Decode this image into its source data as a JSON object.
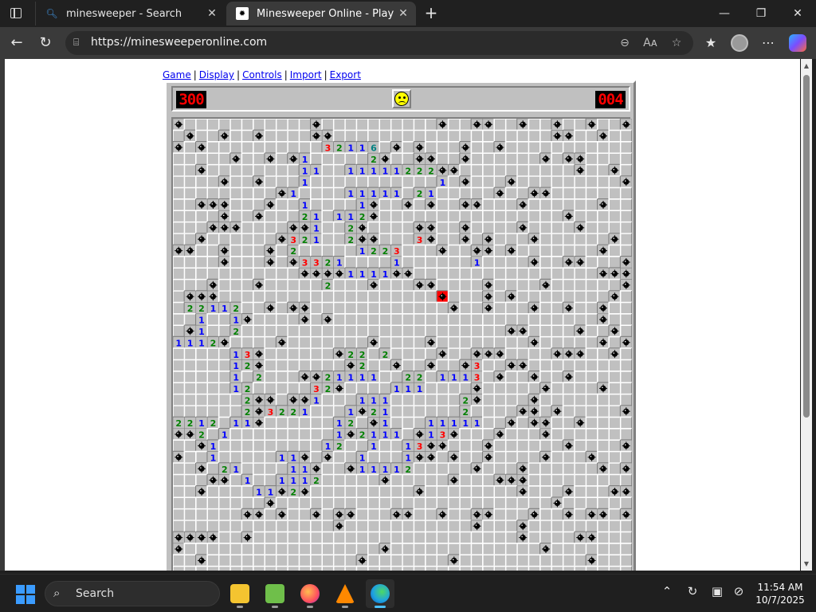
{
  "browser": {
    "tabs": [
      {
        "title": "minesweeper - Search",
        "active": false,
        "icon": "search-icon"
      },
      {
        "title": "Minesweeper Online - Play Free Online",
        "active": true,
        "icon": "minesweeper-favicon"
      }
    ],
    "url": "https://minesweeperonline.com"
  },
  "menu": {
    "game": "Game",
    "display": "Display",
    "controls": "Controls",
    "import": "Import",
    "export": "Export",
    "sep": "|"
  },
  "game": {
    "mines_counter": "300",
    "timer": "004",
    "face": "dead",
    "status": "game-over",
    "cols": 40,
    "visible_rows": 40,
    "board_rows": [
      "*~~~~~~~~~~~*~~~~~~~~~~*~~**~~*~~*~~*~~*",
      "~*~~*~~*~~~~**~~~~~~~~~~~~~~~~~~~**~~*~~",
      "*~*~~~~~~~~~~32116~*~*~~~*~~*~~~~~~~~~~~",
      "~~~~~*~~*~*1~~~~~2*~~**~~*~~~~~~*~**~~~~",
      "~~*~~~~~~~~11~~11111222**~~~~~~~~~~*~~*~",
      "~~~~*~~*~~~1~~~~~~~~~~~1~*~~~*~~~~~~~~~*",
      "~~~~~~~~~*1~~~~11111~21~~~~~*~~**~~~~~~~",
      "~~***~~~*~~1~~~~1*~~*~*~~**~~~*~~~~~~*~~",
      "~~~~*~~*~~~21~112*~~~~~~~~~~~~~~~~*~~~~~",
      "~~~***~~~~**1~~2*~~~~**~~*~~~~*~~~~*~~~~",
      "~~*~~~~~~*321~~2**~~~3*~~*~*~~~*~~~~~~*~",
      "**~~*~~~*~2~~~~~1223~~~*~~**~*~~~~~~~*~~",
      "~~~~*~~~*~*3321~~~~1~~~~~~1~~~~*~~**~~~*",
      "~~~~~~~~~~~****1111**~~~~~~~~~~~~~~~~***",
      "~~~*~~~*~~~~~2~~~*~~~**~~~~*~~~~*~~~~~~*",
      "~***~~~~~~~~~~~~~~~~~~~X~~~*~*~~~~~~~~*~",
      "~22112~~*~**~~~~~~~~~~~~*~~*~~~*~~*~~*~~",
      "~~1~~1*~~~~*~*~~~~~~~~~~~~~~~~~~~~~~~*~~",
      "~*1~~2~~~~~~~~~~~~~~~~~~~~~~~**~~~~*~~*~",
      "1112*~~~~*~~~~~~~*~~~~*~~~~~~~~*~~~~~*~*",
      "~~~~~13*~~~~~~*22~2~~~~*~~***~~~~***~~*~",
      "~~~~~12*~~~~~~~*2~~*~~*~~*3~~**~~~~~~~~~",
      "~~~~~1~2~~~**21111~~22~1113~*~~*~~*~~~~~",
      "~~~~~12~~~~~32*~~~~111~~~~*~~~~~*~~~~*~~",
      "~~~~~~2**~**1~~~111~~~~~~2*~~~~*~~~~~~~~",
      "~~~~~~2*3221~~~1*21~~~~~~2~~~~**~*~~~~~*",
      "2212~11*~~~~~~12~*1~~~11111~~*~**~~*~~~~",
      "**2~1~~~~~~~~~1*2111~*13*~~~*~~~*~~~~~~~",
      "~~*1~~~~~~~~~12~~1~~13**~~~*~~~~~~*~~~~*",
      "*~~1~~~~~11*~*~~1~~~1**~*~~*~~~~*~~~*~~~",
      "~~*~21~~~~11*~~*11112~~~~~*~~~*~~~~~~*~*",
      "~~~**~1~~1112~~~~~*~~~~~*~~~***~~~~~~~~~",
      "~~*~~~~11*2*~~~~~~~~~*~~~~~~~~*~~~*~~~**",
      "~~~~~~~~*~~~~~~~~~~~~~~~~~~~~~~~~*~~~~~~",
      "~~~~~~**~*~~*~**~~~**~~*~~**~~~*~~*~**~*",
      "~~~~~~~~~~~~~~*~~~~~~~~~~~*~~~*~~~~~~~~~",
      "****~~*~~~~~~~~~~~~~~~~~~~~~~~*~~~~**~~~",
      "*~~~~~~~~~~~~~~~~~*~~~~~~~~~~~~~*~~~~~~~",
      "~~*~~~~~~~~~~~~~*~~~~~~~*~~~~~~~~~~~*~~~",
      "~~~~~~~~~~~~~~~~~~~~~~~~~~~~~~~~~~~~~~~~"
    ]
  },
  "taskbar": {
    "search_label": "Search",
    "time": "11:54 AM",
    "date": "10/7/2025",
    "apps": [
      "file-explorer",
      "notepad",
      "firefox",
      "vlc",
      "edge"
    ]
  },
  "colors": {
    "tile": "#c0c0c0",
    "light": "#ffffff",
    "dark": "#808080",
    "mine_bg": "#ff0000",
    "n1": "#0000ff",
    "n2": "#008000",
    "n3": "#ff0000",
    "n4": "#000080",
    "n5": "#800000",
    "n6": "#008080",
    "n7": "#000000",
    "n8": "#808080"
  }
}
